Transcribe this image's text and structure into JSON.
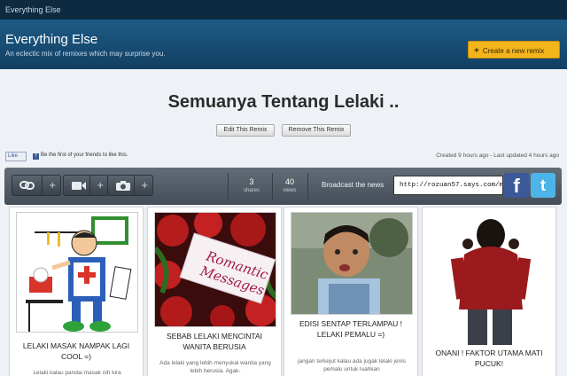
{
  "topbar": {
    "label": "Everything Else"
  },
  "banner": {
    "title": "Everything Else",
    "subtitle": "An eclectic mix of remixes which may surprise you.",
    "create_button": "Create a new remix"
  },
  "remix": {
    "title": "Semuanya Tentang Lelaki ..",
    "edit_button": "Edit This Remix",
    "remove_button": "Remove This Remix"
  },
  "social": {
    "like_button": "Like",
    "like_text": "Be the first of your friends to like this."
  },
  "meta": {
    "text": "Created 9 hours ago - Last updated 4 hours ago"
  },
  "toolbar": {
    "shares": {
      "value": "3",
      "label": "shares"
    },
    "views": {
      "value": "40",
      "label": "views"
    },
    "broadcast_label": "Broadcast the news",
    "share_url": "http://rozuan57.says.com/m"
  },
  "icons": {
    "link": "link-icon",
    "video": "video-camera-icon",
    "photo": "camera-icon",
    "facebook": "facebook-icon",
    "twitter": "twitter-icon"
  },
  "colors": {
    "banner": "#1d5b86",
    "create_button": "#f3b51b",
    "facebook": "#3b5998",
    "twitter": "#4cb4e6"
  },
  "cards": [
    {
      "title": "LELAKI MASAK NAMPAK LAGI COOL =)",
      "desc": "Lelaki kalau pandai masak nih kira"
    },
    {
      "title": "SEBAB LELAKI MENCINTAI WANITA BERUSIA",
      "desc": "Ada lelaki yang lebih menyukai wanita yang lebih berusia. Agak-",
      "image_text": "Romantic Messages"
    },
    {
      "title": "EDISI SENTAP TERLAMPAU ! LELAKI PEMALU =)",
      "desc": "jangan terkejut kalau ada jugak lelaki jenis pemalu untuk luahkan"
    },
    {
      "title": "ONANI ! FAKTOR UTAMA MATI PUCUK!",
      "desc": ""
    }
  ]
}
